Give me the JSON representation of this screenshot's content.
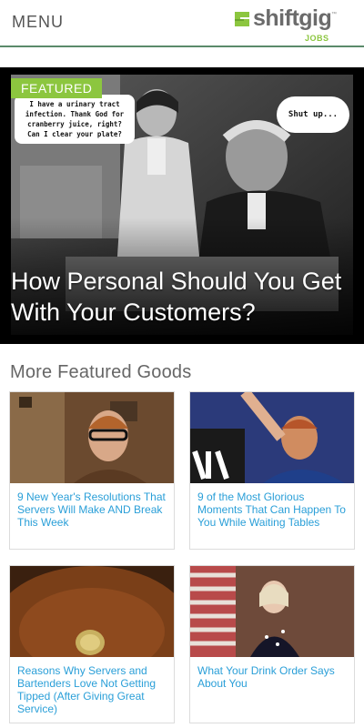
{
  "header": {
    "menu_label": "MENU",
    "logo": {
      "name": "shiftgig",
      "tm": "™",
      "sub": "JOBS",
      "accent": "#8cc63f"
    },
    "divider_color": "#5a8a6a"
  },
  "featured": {
    "badge": "FEATURED",
    "title": "How Personal Should You Get With Your Customers?",
    "bubble_left": "I have a urinary tract infection. Thank God for cranberry juice, right? Can I clear your plate?",
    "bubble_right": "Shut up..."
  },
  "more": {
    "title": "More Featured Goods",
    "cards": [
      {
        "title": "9 New Year's Resolutions That Servers Will Make AND Break This Week"
      },
      {
        "title": "9 of the Most Glorious Moments That Can Happen To You While Waiting Tables"
      },
      {
        "title": "Reasons Why Servers and Bartenders Love Not Getting Tipped (After Giving Great Service)"
      },
      {
        "title": "What Your Drink Order Says About You"
      }
    ]
  },
  "colors": {
    "link": "#2a9fd8",
    "badge": "#8cc63f"
  }
}
